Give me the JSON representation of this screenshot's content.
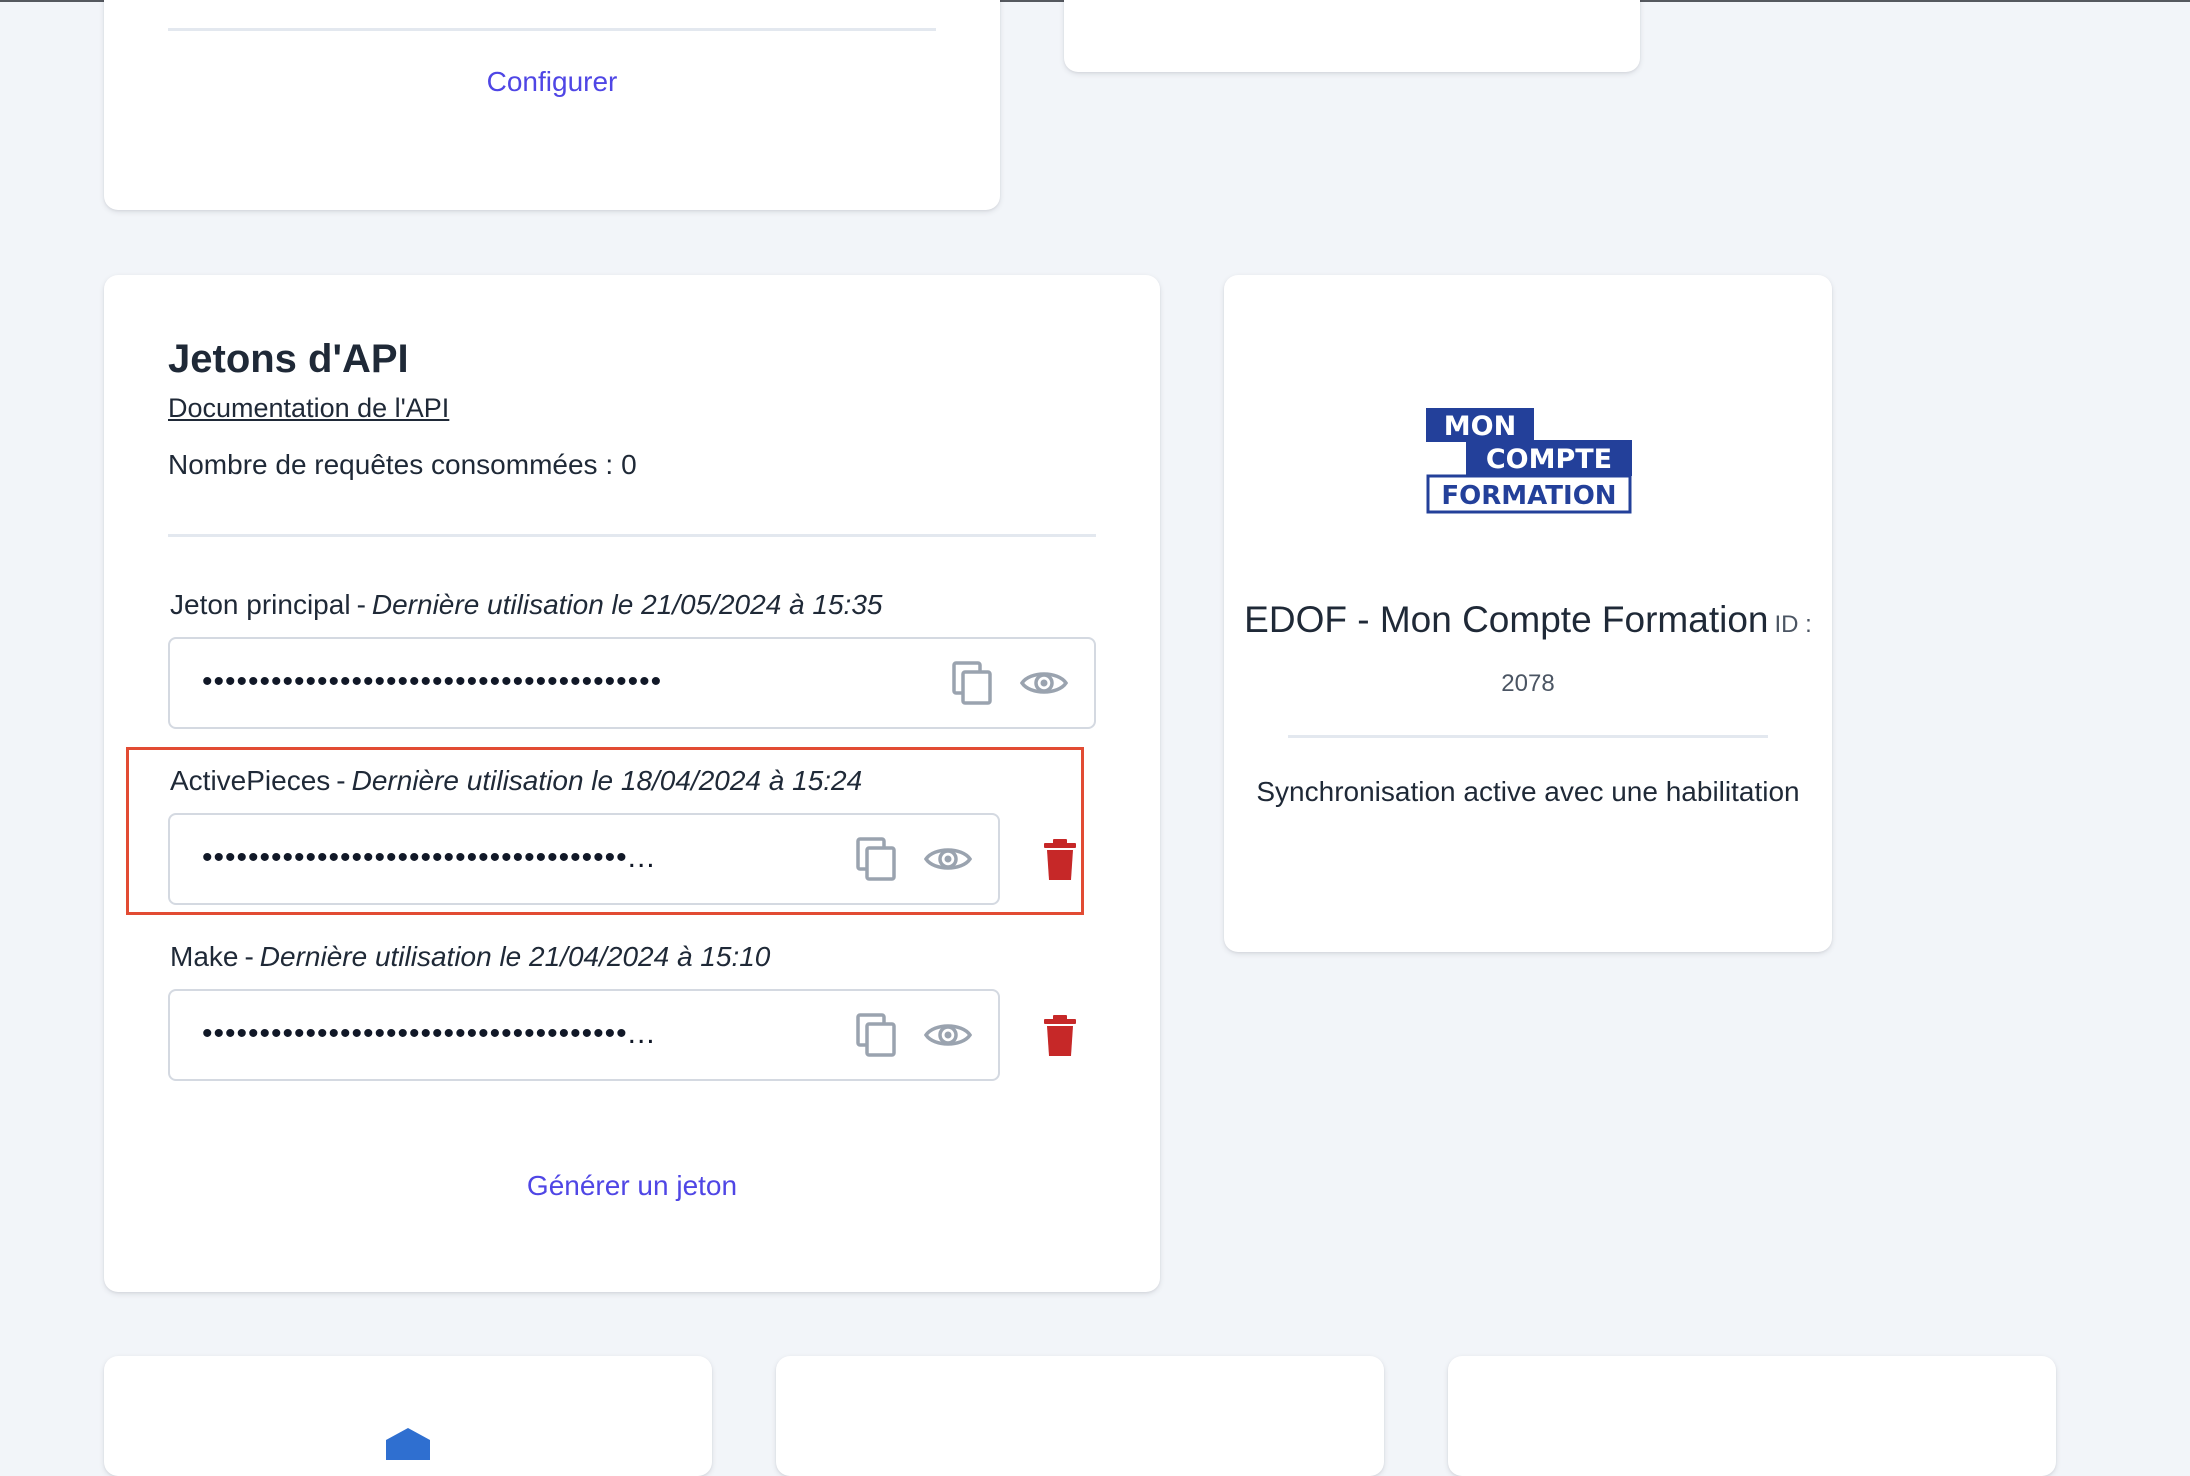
{
  "integration_top_card": {
    "configure_label": "Configurer"
  },
  "api_tokens": {
    "title": "Jetons d'API",
    "documentation_link": "Documentation de l'API",
    "requests_label": "Nombre de requêtes consommées :",
    "requests_count": "0",
    "separator": "-",
    "tokens": [
      {
        "name": "Jeton principal",
        "last_used": "Dernière utilisation le 21/05/2024 à 15:35",
        "masked_value": "••••••••••••••••••••••••••••••••••••••••"
      },
      {
        "name": "ActivePieces",
        "last_used": "Dernière utilisation le 18/04/2024 à 15:24",
        "masked_value": "•••••••••••••••••••••••••••••••••••••..."
      },
      {
        "name": "Make",
        "last_used": "Dernière utilisation le 21/04/2024 à 15:10",
        "masked_value": "•••••••••••••••••••••••••••••••••••••..."
      }
    ],
    "generate_label": "Générer un jeton"
  },
  "edof_card": {
    "logo_text": {
      "line1": "MON",
      "line2": "COMPTE",
      "line3": "FORMATION"
    },
    "title": "EDOF - Mon Compte Formation",
    "id_label": "ID : 2078",
    "status": "Synchronisation active avec une habilitation"
  },
  "icons": {
    "copy": "copy-icon",
    "reveal": "eye-icon",
    "delete": "trash-icon"
  },
  "colors": {
    "background": "#f2f5f9",
    "card": "#ffffff",
    "accent_link": "#4f46e5",
    "delete_red": "#c62828",
    "icon_gray": "#9aa3af",
    "highlight": "#e24b33",
    "logo_blue": "#23409a"
  }
}
